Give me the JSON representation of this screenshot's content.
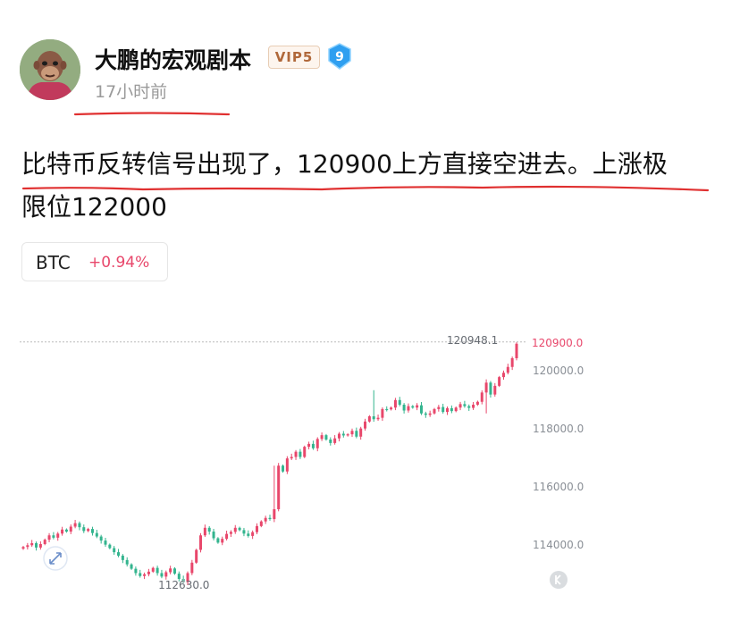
{
  "author": {
    "name": "大鹏的宏观剧本",
    "vip_badge": "VIP5",
    "level": "9",
    "timestamp": "17小时前"
  },
  "post": {
    "line1": "比特币反转信号出现了，120900上方直接空进去。上涨极",
    "line2": "限位122000"
  },
  "ticker": {
    "symbol": "BTC",
    "change": "+0.94%"
  },
  "colors": {
    "up": "#e8476b",
    "down": "#33b48e",
    "annotation": "#e03030"
  },
  "chart_data": {
    "type": "candlestick",
    "y_ticks": [
      "120000.0",
      "118000.0",
      "116000.0",
      "114000.0"
    ],
    "y_tick_values": [
      120000,
      118000,
      116000,
      114000
    ],
    "current_price_label": "120900.0",
    "current_price": 120900,
    "high_label": "120948.1",
    "high": 120948.1,
    "low_label": "112630.0",
    "low": 112630,
    "ylim": [
      112300,
      121500
    ],
    "closes": [
      113900,
      113960,
      114030,
      113880,
      114000,
      114150,
      114300,
      114220,
      114360,
      114500,
      114430,
      114600,
      114720,
      114580,
      114450,
      114520,
      114380,
      114260,
      114120,
      113980,
      113860,
      113720,
      113600,
      113450,
      113300,
      113150,
      113000,
      112900,
      112960,
      113050,
      113180,
      113000,
      112880,
      113030,
      113160,
      112980,
      112800,
      112690,
      113000,
      113360,
      113800,
      114300,
      114560,
      114430,
      114200,
      114050,
      114180,
      114350,
      114420,
      114560,
      114480,
      114360,
      114280,
      114410,
      114620,
      114780,
      114900,
      114860,
      115200,
      116700,
      116500,
      116950,
      117000,
      117180,
      117000,
      117350,
      117450,
      117300,
      117620,
      117750,
      117600,
      117480,
      117640,
      117800,
      117740,
      117780,
      117900,
      117700,
      117980,
      118220,
      118400,
      118300,
      118350,
      118650,
      118640,
      118700,
      118960,
      118800,
      118600,
      118750,
      118700,
      118780,
      118500,
      118450,
      118500,
      118650,
      118720,
      118550,
      118680,
      118580,
      118700,
      118820,
      118750,
      118690,
      118800,
      118900,
      119220,
      119560,
      119150,
      119450,
      119750,
      119900,
      120100,
      120400,
      120900
    ]
  }
}
